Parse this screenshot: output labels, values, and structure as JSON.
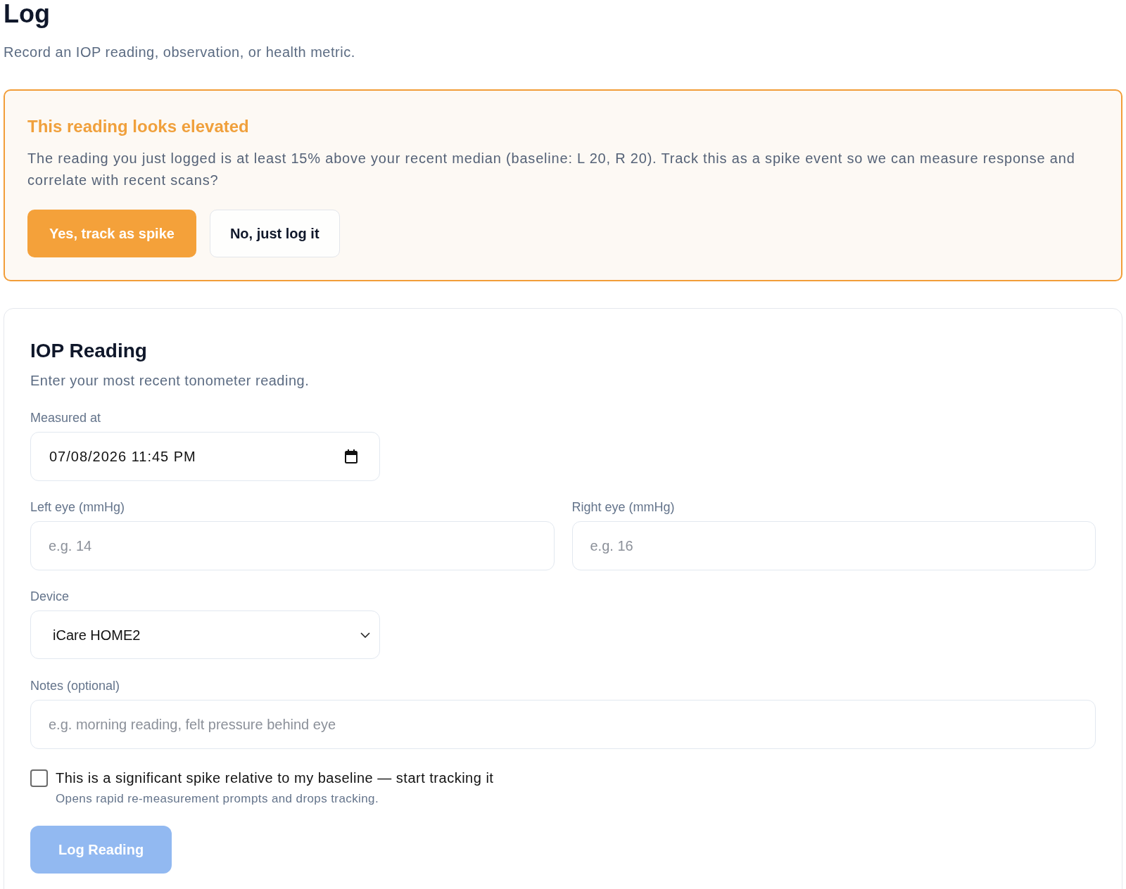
{
  "page": {
    "title": "Log",
    "subtitle": "Record an IOP reading, observation, or health metric."
  },
  "alert": {
    "title": "This reading looks elevated",
    "message": "The reading you just logged is at least 15% above your recent median (baseline: L 20, R 20). Track this as a spike event so we can measure response and correlate with recent scans?",
    "buttons": [
      {
        "label": "Yes, track as spike",
        "kind": "primary"
      },
      {
        "label": "No, just log it",
        "kind": "secondary"
      }
    ]
  },
  "form": {
    "title": "IOP Reading",
    "description": "Enter your most recent tonometer reading.",
    "measured_at": {
      "label": "Measured at",
      "value": "07/08/2026 11:45 PM"
    },
    "left_eye": {
      "label": "Left eye (mmHg)",
      "placeholder": "e.g. 14"
    },
    "right_eye": {
      "label": "Right eye (mmHg)",
      "placeholder": "e.g. 16"
    },
    "device": {
      "label": "Device",
      "value": "iCare HOME2"
    },
    "notes": {
      "label": "Notes (optional)",
      "placeholder": "e.g. morning reading, felt pressure behind eye"
    },
    "spike_checkbox": {
      "label": "This is a significant spike relative to my baseline — start tracking it",
      "hint": "Opens rapid re-measurement prompts and drops tracking.",
      "checked": false
    },
    "submit_button": {
      "label": "Log Reading",
      "disabled": true
    }
  }
}
